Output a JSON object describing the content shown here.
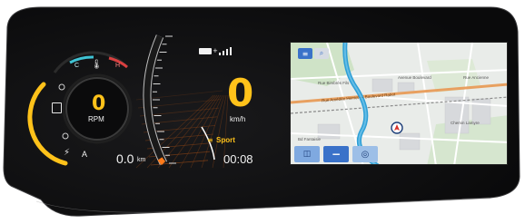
{
  "rpm": {
    "value": "0",
    "label": "RPM",
    "temp_cold": "C",
    "temp_hot": "H",
    "engine_mode": "A"
  },
  "speed": {
    "value": "0",
    "unit": "km/h",
    "mode": "Sport",
    "tachometer_fraction": 0.05
  },
  "trip": {
    "odometer": "0.0",
    "odometer_unit": "km",
    "time": "00:08"
  },
  "status": {
    "battery_icon": "battery-icon",
    "signal_icon": "signal-bars-icon"
  },
  "map": {
    "street_labels": [
      "Rue Bimbrès Fils",
      "Rue Amédée Herriot ··· Boulevard Rabot",
      "Avenue Boulevard",
      "Rue Ancienne",
      "Chemin Lamyre",
      "Bd Fantaisie"
    ],
    "menu_icon": "menu-icon",
    "search_icon": "search-icon",
    "zoom_out_icon": "minus-icon",
    "recenter_icon": "compass-icon"
  },
  "colors": {
    "accent": "#ffc21a",
    "map_bg": "#e9ece9",
    "water": "#2f9fd6",
    "road_main": "#e8a060",
    "map_button": "#3a72c9"
  }
}
